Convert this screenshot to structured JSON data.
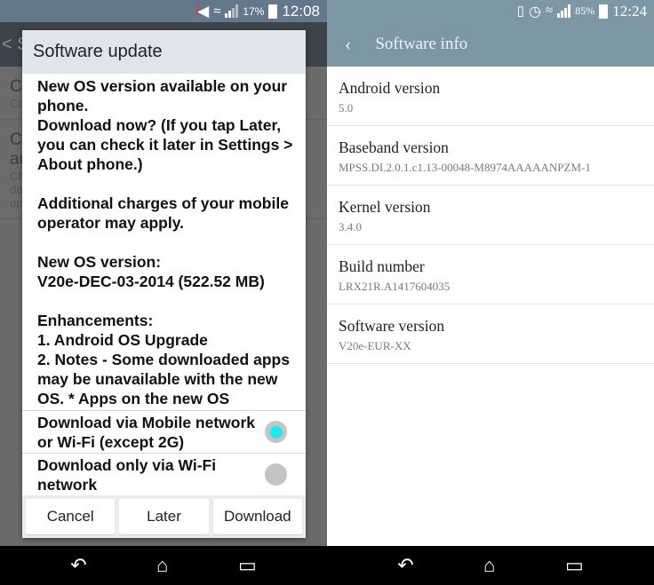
{
  "left": {
    "status": {
      "battery": "17%",
      "time": "12:08"
    },
    "background": {
      "action_bar": "< S",
      "rows": [
        {
          "title": "C",
          "sub": "Co"
        },
        {
          "title": "C\nau",
          "sub": "Ch\ndo\nup"
        }
      ]
    },
    "dialog": {
      "title": "Software update",
      "body": "New OS version available on your phone.\nDownload now? (If you tap Later, you can check it later in Settings > About phone.)\n\nAdditional charges of your mobile operator may apply.\n\nNew OS version:\nV20e-DEC-03-2014 (522.52 MB)\n\nEnhancements:\n1. Android OS Upgrade\n2. Notes - Some downloaded apps may be unavailable with the new OS. * Apps on the new OS",
      "options": [
        {
          "label": "Download via Mobile network or Wi-Fi (except 2G)",
          "selected": true
        },
        {
          "label": "Download only via Wi-Fi network",
          "selected": false
        }
      ],
      "buttons": {
        "cancel": "Cancel",
        "later": "Later",
        "download": "Download"
      }
    }
  },
  "right": {
    "status": {
      "battery": "85%",
      "time": "12:24"
    },
    "title": "Software info",
    "items": [
      {
        "title": "Android version",
        "value": "5.0"
      },
      {
        "title": "Baseband version",
        "value": "MPSS.DI.2.0.1.c1.13-00048-M8974AAAAANPZM-1"
      },
      {
        "title": "Kernel version",
        "value": "3.4.0"
      },
      {
        "title": "Build number",
        "value": "LRX21R.A1417604035"
      },
      {
        "title": "Software version",
        "value": "V20e-EUR-XX"
      }
    ]
  },
  "colors": {
    "accent_radio": "#1de9f0",
    "action_bar": "#7e97a5"
  }
}
